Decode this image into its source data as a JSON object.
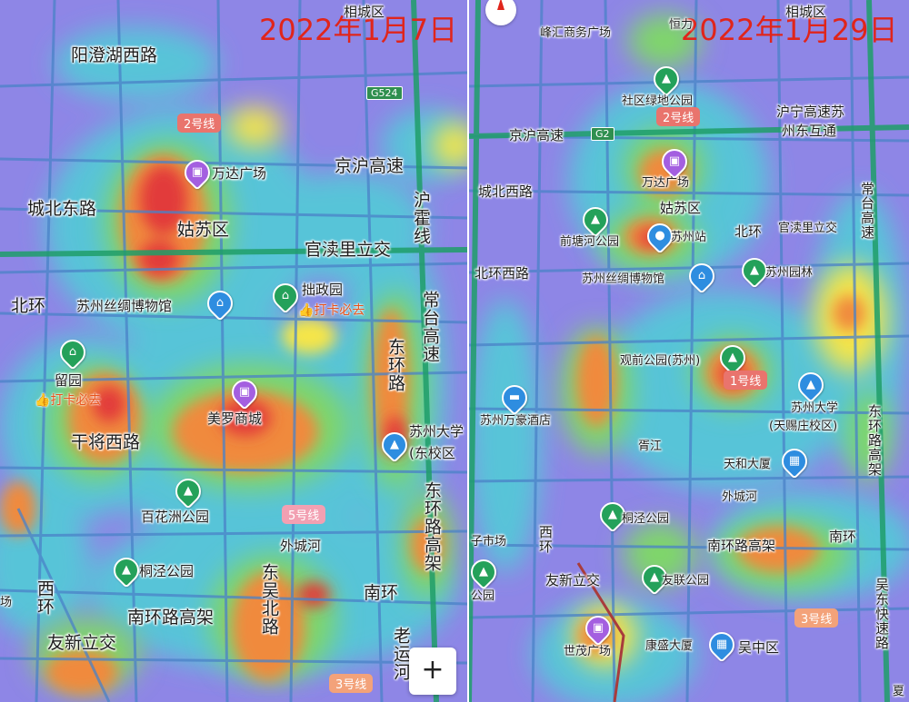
{
  "colors": {
    "heat_low": "#8e86e6",
    "heat_mid": "#55c8d8",
    "heat_green": "#7fd66a",
    "heat_yellow": "#f5e54a",
    "heat_orange": "#f08a3c",
    "heat_red": "#e23a3a",
    "date_text": "#e0251b"
  },
  "left": {
    "date": "2022年1月7日",
    "labels": {
      "xiangcheng": "相城区",
      "yangchenghu": "阳澄湖西路",
      "chengbei": "城北东路",
      "gusu": "姑苏区",
      "wanda": "万达广场",
      "jinghu": "京沪高速",
      "hu": "沪",
      "huning": "霍线",
      "guandu": "官渎里立交",
      "beihuan": "北环",
      "silk": "苏州丝绸博物馆",
      "zhuozheng": "拙政园",
      "checkin1": "打卡必去",
      "changtai": "常台高速",
      "liuyuan": "留园",
      "checkin2": "打卡必去",
      "donghuan": "东环路",
      "meiluo": "美罗商城",
      "suda": "苏州大学",
      "suda_campus": "(东校区",
      "ganjiang": "干将西路",
      "baihuazhou": "百花洲公园",
      "waicheng": "外城河",
      "donghuan_gj": "东环路高架",
      "tongjing": "桐泾公园",
      "xihuan": "西环",
      "nanhuan_gj": "南环路高架",
      "dongwu": "东吴北路",
      "nanhuan": "南环",
      "youxin": "友新立交",
      "chang": "场",
      "laoyun": "老运",
      "he": "河"
    },
    "badges": {
      "line2": "2号线",
      "line5": "5号线",
      "line3": "3号线"
    },
    "shield": "G524",
    "zoom": "+"
  },
  "right": {
    "date": "2022年1月29日",
    "labels": {
      "xiangcheng": "相城区",
      "fenghui": "峰汇商务广场",
      "hengli": "恒力",
      "park_comm": "社区绿地公园",
      "huning_su": "沪宁高速苏",
      "suzhou_east": "州东互通",
      "jinghu": "京沪高速",
      "changtai": "常台高速",
      "chengbei": "城北西路",
      "wanda": "万达广场",
      "gusu": "姑苏区",
      "qiantang": "前塘河公园",
      "station": "苏州站",
      "beihuan": "北环",
      "guandu": "官渎里立交",
      "beihuan_w": "北环西路",
      "silk": "苏州丝绸博物馆",
      "suyuanlin": "苏州园林",
      "guanqian": "观前公园(苏州)",
      "line1": "1号线",
      "wanhao": "苏州万豪酒店",
      "suda": "苏州大学",
      "suda_campus": "(天赐庄校区)",
      "donghuan_gj": "东环路高架",
      "xujiang": "胥江",
      "tianhe": "天和大厦",
      "waicheng": "外城河",
      "tongjing": "桐泾公园",
      "market": "子市场",
      "xihuan": "西环",
      "nanhuan_gj": "南环路高架",
      "nanhuan": "南环",
      "youxin": "友新立交",
      "youlian": "友联公园",
      "wudong": "吴东快速路",
      "park_w": "公园",
      "shimao": "世茂广场",
      "kangsheng": "康盛大厦",
      "wuzhong": "吴中区",
      "xia": "夏"
    },
    "badges": {
      "line2": "2号线",
      "line3": "3号线"
    },
    "shield": "G2"
  }
}
